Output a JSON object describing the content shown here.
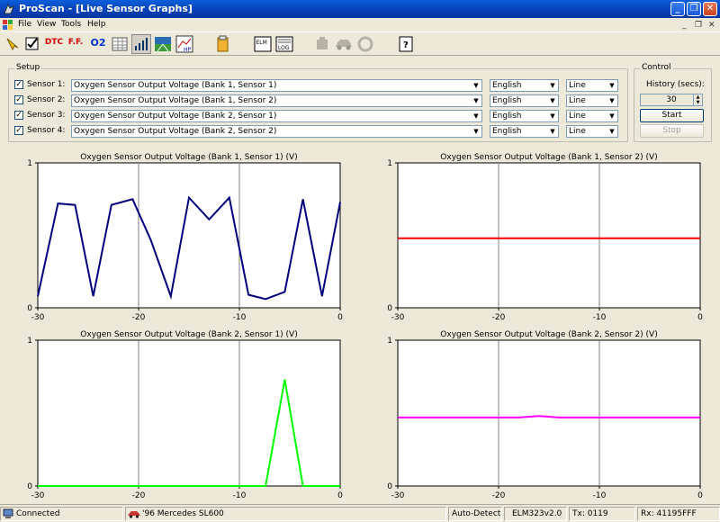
{
  "window": {
    "title": "ProScan - [Live Sensor Graphs]"
  },
  "menu": {
    "items": [
      "File",
      "View",
      "Tools",
      "Help"
    ]
  },
  "toolbar": {
    "buttons": [
      {
        "name": "connect-icon"
      },
      {
        "name": "checklist-icon"
      },
      {
        "name": "dtc-icon",
        "label": "DTC"
      },
      {
        "name": "freeze-frame-icon",
        "label": "F.F."
      },
      {
        "name": "o2-icon",
        "label": "O2"
      },
      {
        "name": "table-icon"
      },
      {
        "name": "bar-graph-icon"
      },
      {
        "name": "dashboard-icon"
      },
      {
        "name": "horsepower-icon",
        "label": "HP"
      },
      {
        "name": "report-icon"
      },
      {
        "name": "elm-icon",
        "label": "ELM"
      },
      {
        "name": "log-icon",
        "label": "LOG"
      },
      {
        "name": "engine-icon"
      },
      {
        "name": "car-icon"
      },
      {
        "name": "tire-icon"
      },
      {
        "name": "help-icon",
        "label": "?"
      }
    ]
  },
  "setup": {
    "label": "Setup",
    "sensors": [
      {
        "label": "Sensor 1:",
        "checked": true,
        "pid": "Oxygen Sensor Output Voltage (Bank 1, Sensor 1)",
        "units": "English",
        "style": "Line"
      },
      {
        "label": "Sensor 2:",
        "checked": true,
        "pid": "Oxygen Sensor Output Voltage (Bank 1, Sensor 2)",
        "units": "English",
        "style": "Line"
      },
      {
        "label": "Sensor 3:",
        "checked": true,
        "pid": "Oxygen Sensor Output Voltage (Bank 2, Sensor 1)",
        "units": "English",
        "style": "Line"
      },
      {
        "label": "Sensor 4:",
        "checked": true,
        "pid": "Oxygen Sensor Output Voltage (Bank 2, Sensor 2)",
        "units": "English",
        "style": "Line"
      }
    ]
  },
  "control": {
    "label": "Control",
    "history_label": "History (secs):",
    "history_value": "30",
    "start_label": "Start",
    "stop_label": "Stop"
  },
  "chart_data": [
    {
      "type": "line",
      "title": "Oxygen Sensor Output Voltage (Bank 1, Sensor 1) (V)",
      "color": "#00007f",
      "xlim": [
        -30,
        0
      ],
      "ylim": [
        0,
        1
      ],
      "xticks": [
        "-30",
        "-20",
        "-10",
        "0"
      ],
      "yticks": [
        "0",
        "1"
      ],
      "x": [
        -30,
        -28,
        -26.3,
        -24.5,
        -22.7,
        -20.6,
        -18.8,
        -16.8,
        -15,
        -13,
        -11,
        -9.1,
        -7.4,
        -5.5,
        -3.7,
        -1.8,
        0
      ],
      "y": [
        0.08,
        0.72,
        0.71,
        0.08,
        0.71,
        0.75,
        0.47,
        0.08,
        0.76,
        0.61,
        0.76,
        0.09,
        0.06,
        0.11,
        0.75,
        0.08,
        0.73
      ]
    },
    {
      "type": "line",
      "title": "Oxygen Sensor Output Voltage (Bank 1, Sensor 2) (V)",
      "color": "#ff0000",
      "xlim": [
        -30,
        0
      ],
      "ylim": [
        0,
        1
      ],
      "xticks": [
        "-30",
        "-20",
        "-10",
        "0"
      ],
      "yticks": [
        "0",
        "1"
      ],
      "x": [
        -30,
        0
      ],
      "y": [
        0.48,
        0.48
      ]
    },
    {
      "type": "line",
      "title": "Oxygen Sensor Output Voltage (Bank 2, Sensor 1) (V)",
      "color": "#00ff00",
      "xlim": [
        -30,
        0
      ],
      "ylim": [
        0,
        1
      ],
      "xticks": [
        "-30",
        "-20",
        "-10",
        "0"
      ],
      "yticks": [
        "0",
        "1"
      ],
      "x": [
        -30,
        -7.4,
        -5.5,
        -3.7,
        0
      ],
      "y": [
        0.0,
        0.0,
        0.73,
        0.0,
        0.0
      ]
    },
    {
      "type": "line",
      "title": "Oxygen Sensor Output Voltage (Bank 2, Sensor 2) (V)",
      "color": "#ff00ff",
      "xlim": [
        -30,
        0
      ],
      "ylim": [
        0,
        1
      ],
      "xticks": [
        "-30",
        "-20",
        "-10",
        "0"
      ],
      "yticks": [
        "0",
        "1"
      ],
      "x": [
        -30,
        -18,
        -16,
        -14,
        0
      ],
      "y": [
        0.47,
        0.47,
        0.48,
        0.47,
        0.47
      ]
    }
  ],
  "status": {
    "connection": "Connected",
    "vehicle": "'96 Mercedes SL600",
    "protocol": "Auto-Detect",
    "interface": "ELM323v2.0",
    "tx": "Tx: 0119",
    "rx": "Rx: 41195FFF"
  }
}
